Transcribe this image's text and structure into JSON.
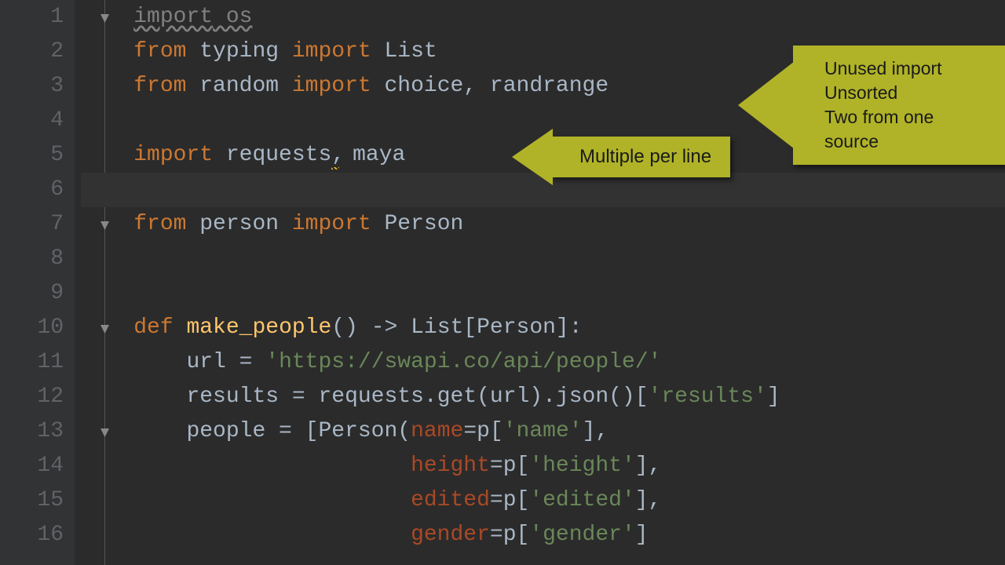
{
  "gutter": {
    "lines": [
      "1",
      "2",
      "3",
      "4",
      "5",
      "6",
      "7",
      "8",
      "9",
      "10",
      "11",
      "12",
      "13",
      "14",
      "15",
      "16"
    ]
  },
  "code": {
    "l1": {
      "kw": "import",
      "mod": " os"
    },
    "l2": {
      "kw1": "from",
      "mod": " typing ",
      "kw2": "import",
      "names": " List"
    },
    "l3": {
      "kw1": "from",
      "mod": " random ",
      "kw2": "import",
      "names": " choice, randrange"
    },
    "l5": {
      "kw": "import",
      "mod1": " requests",
      "comma": ",",
      "mod2": " maya"
    },
    "l7": {
      "kw1": "from",
      "mod": " person ",
      "kw2": "import",
      "names": " Person"
    },
    "l10": {
      "kw": "def",
      "name": " make_people",
      "sig": "() -> List[Person]:"
    },
    "l11": {
      "ind": "    ",
      "var": "url = ",
      "str": "'https://swapi.co/api/people/'"
    },
    "l12": {
      "ind": "    ",
      "text": "results = requests.get(url).json()[",
      "str": "'results'",
      "end": "]"
    },
    "l13": {
      "ind": "    ",
      "text": "people = [Person(",
      "pk": "name",
      "eq": "=p[",
      "str": "'name'",
      "end": "],"
    },
    "l14": {
      "ind": "                     ",
      "pk": "height",
      "eq": "=p[",
      "str": "'height'",
      "end": "],"
    },
    "l15": {
      "ind": "                     ",
      "pk": "edited",
      "eq": "=p[",
      "str": "'edited'",
      "end": "],"
    },
    "l16": {
      "ind": "                     ",
      "pk": "gender",
      "eq": "=p[",
      "str": "'gender'",
      "end": "]"
    }
  },
  "callouts": {
    "small": "Multiple per line",
    "big_l1": "Unused import",
    "big_l2": "Unsorted",
    "big_l3": "Two from one source"
  }
}
